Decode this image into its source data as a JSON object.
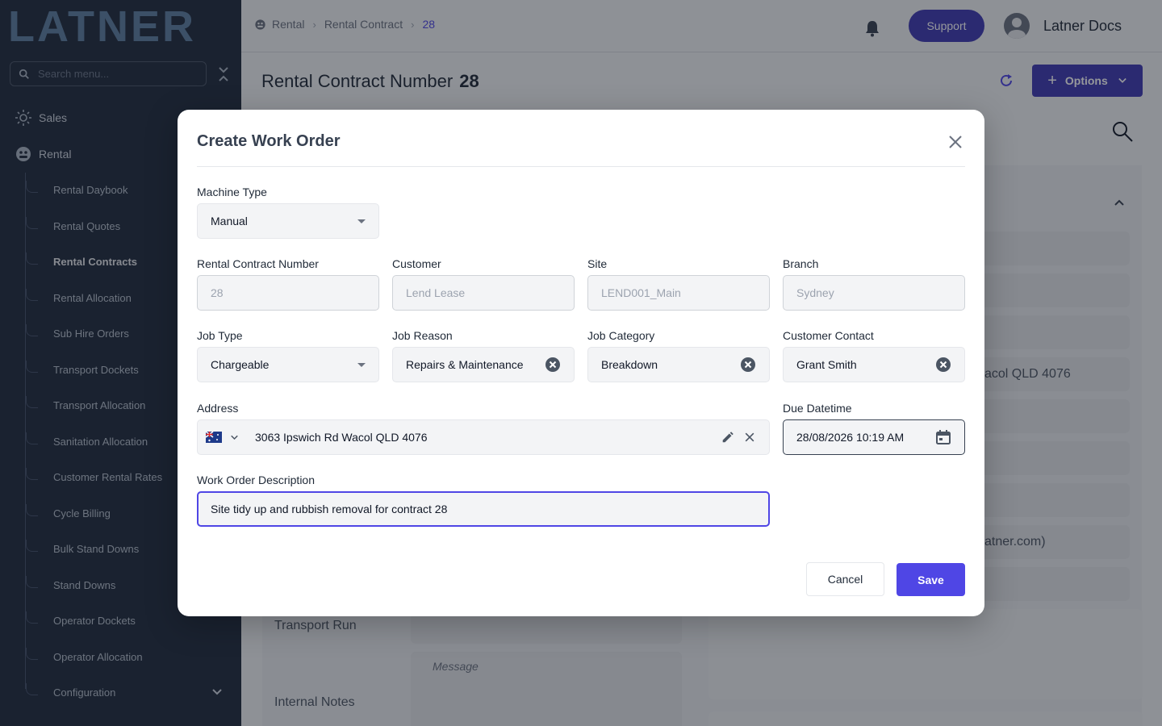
{
  "sidebar": {
    "logo": "LATNER",
    "search_placeholder": "Search menu...",
    "top_items": [
      {
        "label": "Sales"
      },
      {
        "label": "Rental"
      }
    ],
    "rental_items": [
      {
        "label": "Rental Daybook"
      },
      {
        "label": "Rental Quotes"
      },
      {
        "label": "Rental Contracts",
        "active": true
      },
      {
        "label": "Rental Allocation"
      },
      {
        "label": "Sub Hire Orders"
      },
      {
        "label": "Transport Dockets"
      },
      {
        "label": "Transport Allocation"
      },
      {
        "label": "Sanitation Allocation"
      },
      {
        "label": "Customer Rental Rates"
      },
      {
        "label": "Cycle Billing"
      },
      {
        "label": "Bulk Stand Downs"
      },
      {
        "label": "Stand Downs"
      },
      {
        "label": "Operator Dockets"
      },
      {
        "label": "Operator Allocation"
      },
      {
        "label": "Configuration"
      }
    ]
  },
  "header": {
    "breadcrumb": [
      "Rental",
      "Rental Contract",
      "28"
    ],
    "support_label": "Support",
    "user_name": "Latner Docs"
  },
  "page": {
    "title": "Rental Contract Number",
    "number": "28",
    "options_label": "Options",
    "bg_texts": {
      "address_fragment": "acol QLD 4076",
      "email_fragment": "atner.com)",
      "transport_run": "Transport Run",
      "internal_notes": "Internal Notes",
      "message_placeholder": "Message"
    }
  },
  "modal": {
    "title": "Create Work Order",
    "machine_type": {
      "label": "Machine Type",
      "value": "Manual"
    },
    "rental_contract_number": {
      "label": "Rental Contract Number",
      "value": "28"
    },
    "customer": {
      "label": "Customer",
      "value": "Lend Lease"
    },
    "site": {
      "label": "Site",
      "value": "LEND001_Main"
    },
    "branch": {
      "label": "Branch",
      "value": "Sydney"
    },
    "job_type": {
      "label": "Job Type",
      "value": "Chargeable"
    },
    "job_reason": {
      "label": "Job Reason",
      "value": "Repairs & Maintenance"
    },
    "job_category": {
      "label": "Job Category",
      "value": "Breakdown"
    },
    "customer_contact": {
      "label": "Customer Contact",
      "value": "Grant Smith"
    },
    "address": {
      "label": "Address",
      "value": "3063 Ipswich Rd Wacol QLD 4076"
    },
    "due_datetime": {
      "label": "Due Datetime",
      "value": "28/08/2026 10:19 AM"
    },
    "description": {
      "label": "Work Order Description",
      "value": "Site tidy up and rubbish removal for contract 28"
    },
    "cancel_label": "Cancel",
    "save_label": "Save"
  },
  "colors": {
    "sidebar_bg": "#1f2a3c",
    "accent": "#4f46e5",
    "support_btn": "#3f3ab3"
  }
}
